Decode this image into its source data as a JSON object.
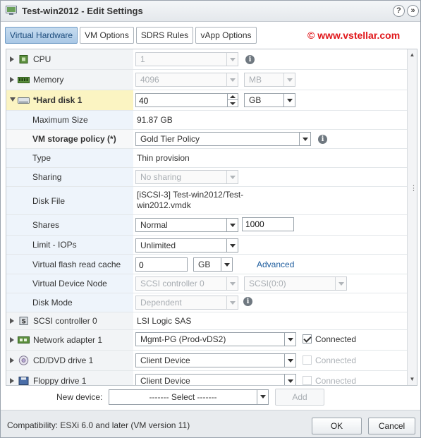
{
  "window": {
    "title": "Test-win2012 - Edit Settings",
    "help_label": "?",
    "expand_label": "»"
  },
  "tabs": [
    {
      "label": "Virtual Hardware",
      "active": true
    },
    {
      "label": "VM Options",
      "active": false
    },
    {
      "label": "SDRS Rules",
      "active": false
    },
    {
      "label": "vApp Options",
      "active": false
    }
  ],
  "watermark": "© www.vstellar.com",
  "hardware": {
    "cpu": {
      "label": "CPU",
      "value": "1"
    },
    "memory": {
      "label": "Memory",
      "value": "4096",
      "unit": "MB"
    },
    "hard_disk": {
      "label": "*Hard disk 1",
      "size": "40",
      "unit": "GB",
      "maximum_size": {
        "label": "Maximum Size",
        "value": "91.87 GB"
      },
      "storage_policy": {
        "label": "VM storage policy (*)",
        "value": "Gold Tier Policy"
      },
      "type": {
        "label": "Type",
        "value": "Thin provision"
      },
      "sharing": {
        "label": "Sharing",
        "value": "No sharing"
      },
      "disk_file": {
        "label": "Disk File",
        "line1": "[iSCSI-3] Test-win2012/Test-",
        "line2": "win2012.vmdk"
      },
      "shares": {
        "label": "Shares",
        "value": "Normal",
        "amount": "1000"
      },
      "limit_iops": {
        "label": "Limit - IOPs",
        "value": "Unlimited"
      },
      "flash_cache": {
        "label": "Virtual flash read cache",
        "value": "0",
        "unit": "GB",
        "advanced": "Advanced"
      },
      "device_node": {
        "label": "Virtual Device Node",
        "controller": "SCSI controller 0",
        "slot": "SCSI(0:0)"
      },
      "disk_mode": {
        "label": "Disk Mode",
        "value": "Dependent"
      }
    },
    "scsi": {
      "label": "SCSI controller 0",
      "value": "LSI Logic SAS"
    },
    "network": {
      "label": "Network adapter 1",
      "value": "Mgmt-PG (Prod-vDS2)",
      "connected_label": "Connected",
      "connected": true
    },
    "cd_dvd": {
      "label": "CD/DVD drive 1",
      "value": "Client Device",
      "connected_label": "Connected",
      "connected": false
    },
    "floppy": {
      "label": "Floppy drive 1",
      "value": "Client Device",
      "connected_label": "Connected",
      "connected": false
    }
  },
  "new_device": {
    "label": "New device:",
    "select_value": "------- Select -------",
    "add_label": "Add"
  },
  "footer": {
    "compatibility": "Compatibility: ESXi 6.0 and later (VM version 11)",
    "ok_label": "OK",
    "cancel_label": "Cancel"
  },
  "colors": {
    "label_bg": "#eef4fb",
    "highlight_bg": "#fbf4c2",
    "tab_active": "#a9c8e6",
    "watermark": "#e0171b",
    "link": "#1e5d9e"
  }
}
